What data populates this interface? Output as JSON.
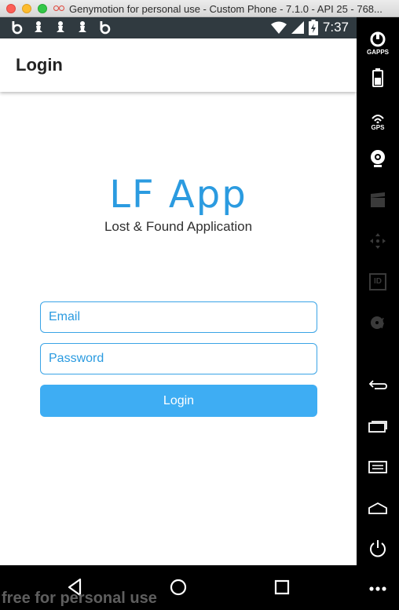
{
  "window": {
    "title": "Genymotion for personal use - Custom Phone - 7.1.0 - API 25 - 768..."
  },
  "status_bar": {
    "time": "7:37",
    "battery_icon_text": "5"
  },
  "app_bar": {
    "title": "Login"
  },
  "logo": {
    "title": "LF App",
    "subtitle": "Lost & Found Application",
    "color": "#2b9be0"
  },
  "form": {
    "email_placeholder": "Email",
    "password_placeholder": "Password",
    "login_label": "Login",
    "accent_color": "#3eadf3"
  },
  "side_toolbar": {
    "gapps_label": "GAPPS",
    "gps_label": "GPS",
    "id_label": "ID"
  },
  "watermark": "free for personal use"
}
